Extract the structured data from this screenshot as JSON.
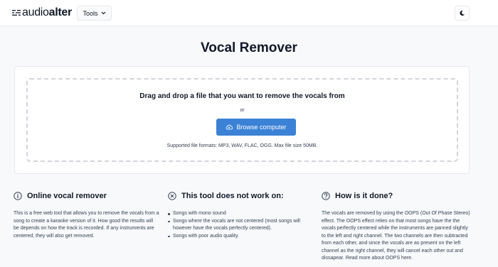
{
  "header": {
    "logo_prefix": "audio",
    "logo_suffix": "alter",
    "tools_label": "Tools"
  },
  "main": {
    "title": "Vocal Remover",
    "dropzone": {
      "heading": "Drag and drop a file that you want to remove the vocals from",
      "or_text": "or",
      "browse_label": "Browse computer",
      "formats": "Supported file formats: MP3, WAV, FLAC, OGG. Max file size 50MB."
    }
  },
  "info": {
    "online": {
      "title": "Online vocal remover",
      "body": "This is a free web tool that allows you to remove the vocals from a song to create a karaoke version of it. How good the results will be depends on how the track is recorded. If any instruments are centered, they will also get removed."
    },
    "not_work": {
      "title": "This tool does not work on:",
      "items": [
        "Songs with mono sound",
        "Songs where the vocals are not centered (most songs will however have the vocals perfectly centered).",
        "Songs with poor audio quality."
      ]
    },
    "how": {
      "title": "How is it done?",
      "body": "The vocals are removed by using the OOPS (Out Of Phase Stereo) effect. The OOPS effect relies on that most songs have the the vocals perfectly centered while the instruments are panned slightly to the left and right channel. The two channels are then subtracted from each other, and since the vocals are as present on the left channel as the right channel, they will cancel each other out and dissapear. Read more about OOPS here."
    }
  },
  "colors": {
    "accent": "#3b82d6",
    "background": "#f7f9fb",
    "card": "#ffffff"
  },
  "icons": [
    "equalizer-logo-icon",
    "chevron-down-icon",
    "moon-icon",
    "cloud-upload-icon",
    "info-circle-icon",
    "x-circle-icon",
    "question-circle-icon"
  ]
}
